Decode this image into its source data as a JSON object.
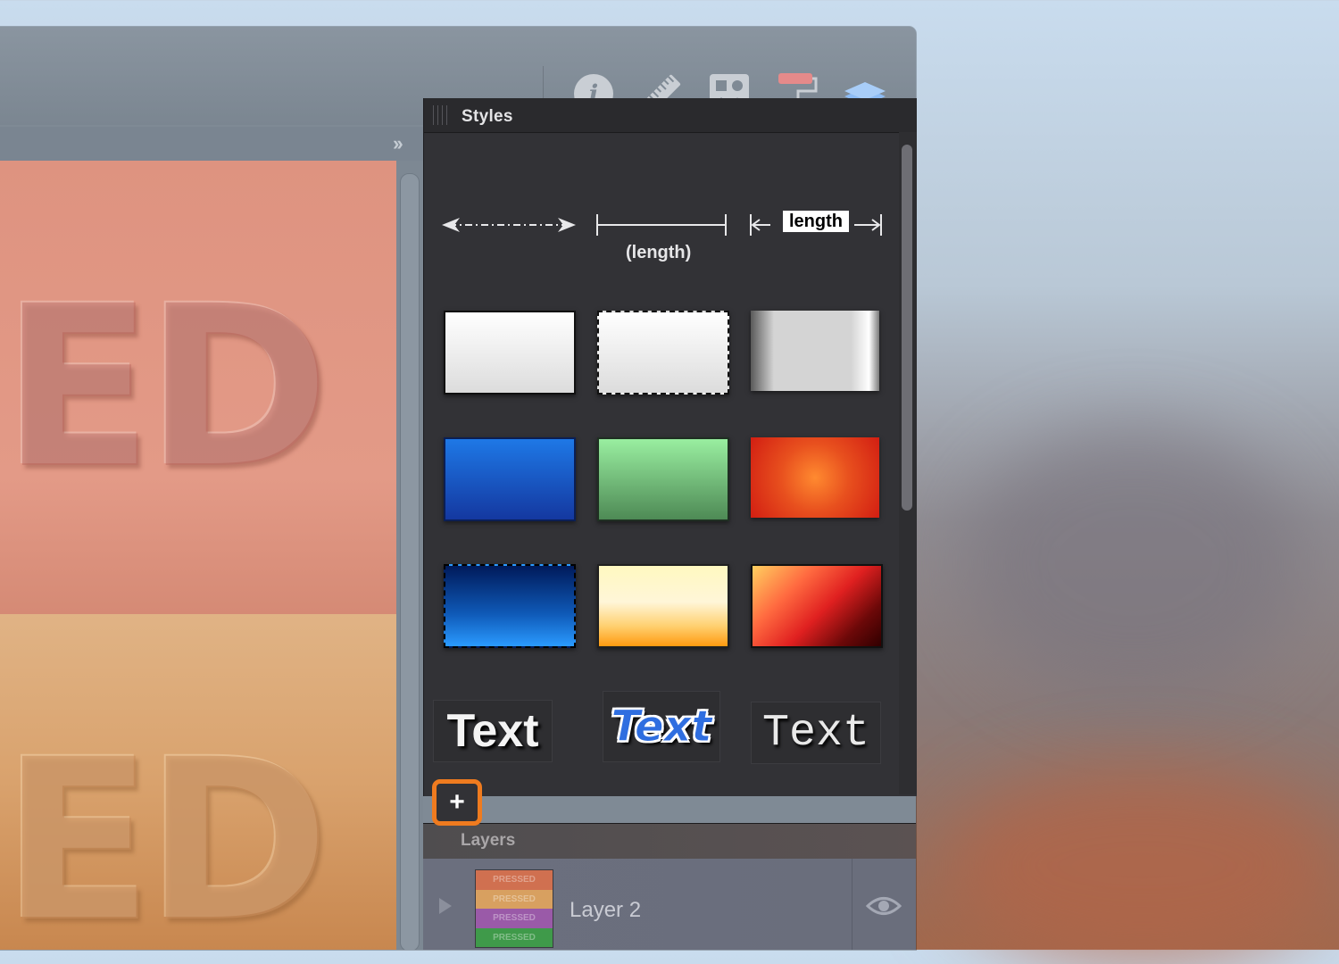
{
  "toolbar": {
    "icons": [
      "info-icon",
      "ruler-icon",
      "shapes-icon",
      "paint-roller-icon",
      "layers-icon"
    ]
  },
  "canvas": {
    "top_text": "ED",
    "bottom_text": "ED"
  },
  "styles_panel": {
    "title": "Styles",
    "length_label": "(length)",
    "length_box": "length",
    "text_styles": [
      "Text",
      "Text",
      "Text"
    ],
    "add_label": "+"
  },
  "layers_panel": {
    "title": "Layers",
    "layer": {
      "name": "Layer 2",
      "thumb_rows": [
        "PRESSED",
        "PRESSED",
        "PRESSED",
        "PRESSED"
      ]
    }
  },
  "colors": {
    "accent_orange": "#ef7b1f",
    "layers_icon_blue": "#6fa8f0",
    "roller_pink": "#e58a8a"
  }
}
